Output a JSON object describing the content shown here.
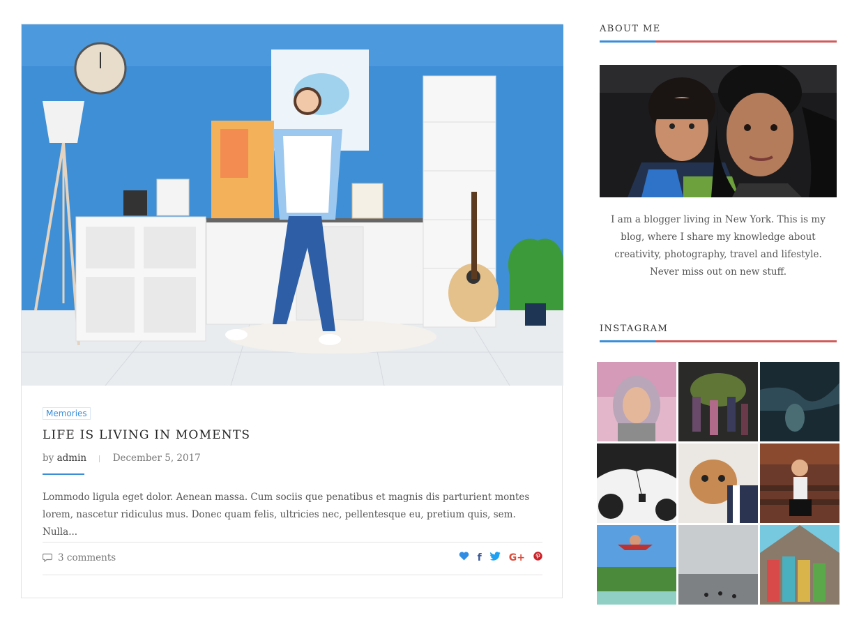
{
  "post": {
    "category": "Memories",
    "title": "LIFE IS LIVING IN MOMENTS",
    "by_label": "by",
    "author": "admin",
    "date": "December 5, 2017",
    "excerpt": "Lommodo ligula eget dolor. Aenean massa. Cum sociis que penatibus et magnis dis parturient montes lorem, nascetur ridiculus mus. Donec quam felis, ultricies nec, pellentesque eu, pretium quis, sem. Nulla...",
    "comments": "3 comments",
    "share_icons": [
      "heart-icon",
      "facebook-icon",
      "twitter-icon",
      "google-plus-icon",
      "pinterest-icon"
    ],
    "share_glyphs": {
      "facebook": "f",
      "google_plus": "G+"
    }
  },
  "sidebar": {
    "about": {
      "title": "ABOUT ME",
      "text": "I am a blogger living in New York. This is my blog, where I share my knowledge about creativity, photography, travel and lifestyle. Never miss out on new stuff."
    },
    "instagram": {
      "title": "INSTAGRAM"
    }
  },
  "colors": {
    "accent_blue": "#3a8ed8",
    "accent_red": "#d05b5b",
    "heart": "#2f8de4",
    "facebook": "#3b5998",
    "twitter": "#1da1f2",
    "google_plus": "#dd4b39",
    "pinterest": "#cb2027"
  }
}
